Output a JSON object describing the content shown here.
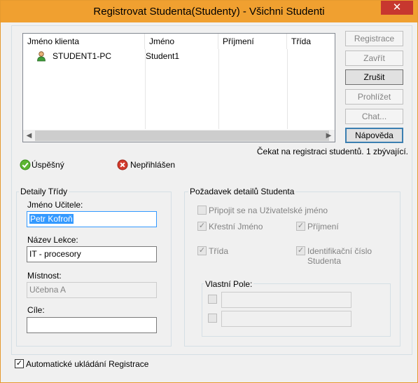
{
  "window": {
    "title": "Registrovat Studenta(Studenty) - Všichni Studenti",
    "close_glyph": "✕"
  },
  "list": {
    "columns": [
      "Jméno klienta",
      "Jméno",
      "Příjmení",
      "Třída"
    ],
    "rows": [
      {
        "client": "STUDENT1-PC",
        "first_name": "Student1",
        "last_name": "",
        "class": ""
      }
    ],
    "icon": "user-icon"
  },
  "buttons": {
    "register": "Registrace",
    "close": "Zavřít",
    "cancel": "Zrušit",
    "browse": "Prohlížet",
    "chat": "Chat...",
    "help": "Nápověda"
  },
  "status_text": "Čekat na registraci studentů. 1 zbývající.",
  "legend": {
    "success": "Úspěšný",
    "not_logged": "Nepřihlášen"
  },
  "class_details": {
    "title": "Detaily Třídy",
    "teacher_label": "Jméno Učitele:",
    "teacher_value": "Petr Kofroň",
    "lesson_label": "Název Lekce:",
    "lesson_value": "IT - procesory",
    "room_label": "Místnost:",
    "room_value": "Učebna A",
    "goals_label": "Cíle:",
    "goals_value": ""
  },
  "student_details": {
    "title": "Požadavek detailů Studenta",
    "connect_username": "Připojit se na Uživatelské jméno",
    "first_name": "Křestní Jméno",
    "last_name": "Příjmení",
    "class": "Třída",
    "student_id": "Identifikační číslo Studenta",
    "custom_title": "Vlastní Pole:"
  },
  "auto_save": "Automatické ukládání Registrace",
  "colors": {
    "title_bar": "#f0a030",
    "close_button": "#c7372f",
    "selection": "#3399ff",
    "success": "#5cb531",
    "error": "#d33a2c"
  }
}
